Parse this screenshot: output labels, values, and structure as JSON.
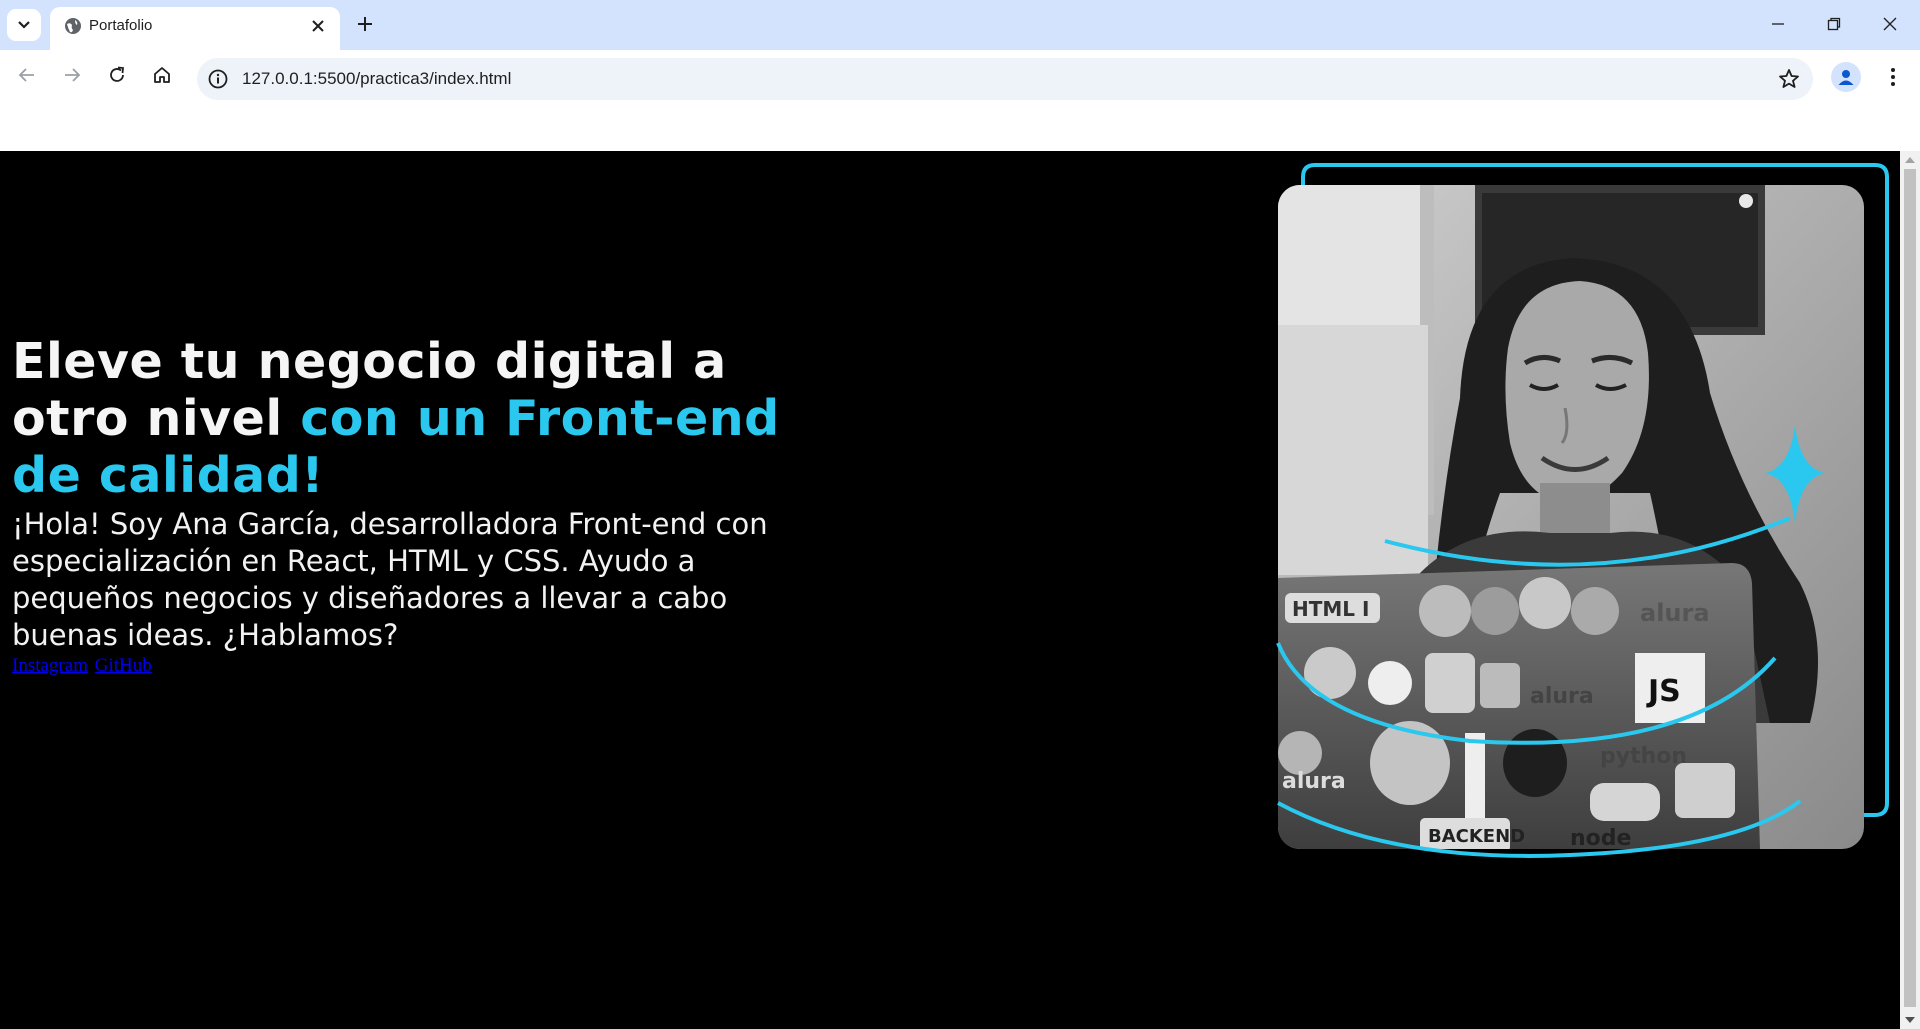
{
  "browser": {
    "tab_title": "Portafolio",
    "url": "127.0.0.1:5500/practica3/index.html"
  },
  "hero": {
    "headline_plain": "Eleve tu negocio digital a otro nivel ",
    "headline_accent": "con un Front-end de calidad!",
    "intro": "¡Hola! Soy Ana García, desarrolladora Front-end con especialización en React, HTML y CSS. Ayudo a pequeños negocios y diseñadores a llevar a cabo buenas ideas. ¿Hablamos?",
    "links": [
      {
        "label": "Instagram"
      },
      {
        "label": "GitHub"
      }
    ],
    "photo_sticker_text": [
      "HTML",
      "I",
      "alura",
      "JS",
      "python",
      "BACKEND",
      "node"
    ]
  },
  "colors": {
    "accent": "#2ac8ee",
    "tabstrip": "#d3e3fd",
    "page_bg": "#000000"
  },
  "icons": [
    "tab-search-icon",
    "globe-icon",
    "close-icon",
    "plus-icon",
    "minimize-icon",
    "restore-icon",
    "window-close-icon",
    "back-arrow-icon",
    "forward-arrow-icon",
    "reload-icon",
    "home-icon",
    "site-info-icon",
    "star-icon",
    "profile-icon",
    "kebab-menu-icon"
  ]
}
